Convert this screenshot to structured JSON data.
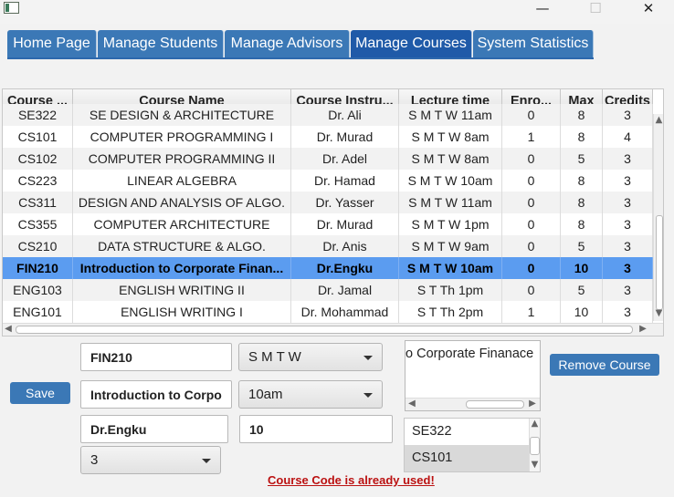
{
  "window": {
    "minimize_glyph": "—",
    "maximize_glyph": "☐",
    "close_glyph": "✕"
  },
  "tabs": [
    "Home Page",
    "Manage Students",
    "Manage Advisors",
    "Manage Courses",
    "System Statistics"
  ],
  "active_tab": "Manage Courses",
  "table": {
    "columns": [
      "Course ...",
      "Course Name",
      "Course Instru...",
      "Lecture time",
      "Enro...",
      "Max",
      "Credits"
    ],
    "partial_row": [
      "SE322",
      "SE DESIGN & ARCHITECTURE",
      "Dr. Ali",
      "S M T W  11am",
      "0",
      "8",
      "3"
    ],
    "rows": [
      [
        "CS101",
        "COMPUTER PROGRAMMING I",
        "Dr. Murad",
        "S M T W  8am",
        "1",
        "8",
        "4"
      ],
      [
        "CS102",
        "COMPUTER PROGRAMMING II",
        "Dr. Adel",
        "S M T W  8am",
        "0",
        "5",
        "3"
      ],
      [
        "CS223",
        "LINEAR ALGEBRA",
        "Dr. Hamad",
        "S M T W  10am",
        "0",
        "8",
        "3"
      ],
      [
        "CS311",
        "DESIGN AND ANALYSIS OF ALGO.",
        "Dr. Yasser",
        "S M T W  11am",
        "0",
        "8",
        "3"
      ],
      [
        "CS355",
        "COMPUTER ARCHITECTURE",
        "Dr. Murad",
        "S M T W  1pm",
        "0",
        "8",
        "3"
      ],
      [
        "CS210",
        "DATA STRUCTURE & ALGO.",
        "Dr. Anis",
        "S M T W  9am",
        "0",
        "5",
        "3"
      ],
      [
        "FIN210",
        "Introduction to Corporate Finan...",
        "Dr.Engku",
        "S M T W  10am",
        "0",
        "10",
        "3"
      ],
      [
        "ENG103",
        "ENGLISH WRITING II",
        "Dr. Jamal",
        "S T Th  1pm",
        "0",
        "5",
        "3"
      ],
      [
        "ENG101",
        "ENGLISH WRITING I",
        "Dr. Mohammad",
        "S T Th  2pm",
        "1",
        "10",
        "3"
      ]
    ],
    "selected_row_index": 6
  },
  "form": {
    "course_code": "FIN210",
    "days_combo": "S M T W",
    "course_name": "Introduction to Corpo",
    "time_combo": "10am",
    "instructor": "Dr.Engku",
    "max_students": "10",
    "credits_combo": "3",
    "save_label": "Save",
    "remove_label": "Remove Course",
    "description_text": "o Corporate Finanace",
    "list_items": [
      "SE322",
      "CS101"
    ],
    "selected_list_item": "CS101",
    "error_message": "Course Code is already used!"
  }
}
